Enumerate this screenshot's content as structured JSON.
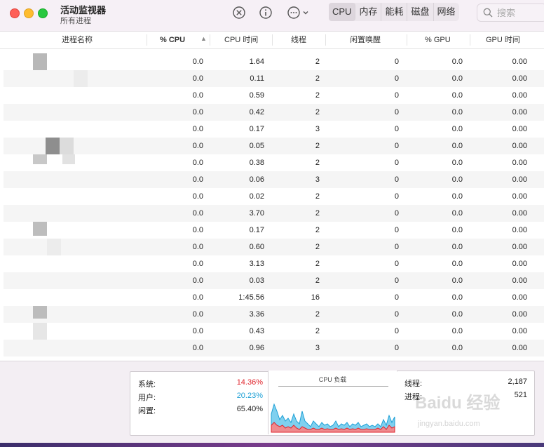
{
  "window": {
    "title": "活动监视器",
    "subtitle": "所有进程"
  },
  "toolbar": {
    "icons": [
      "stop-process-icon",
      "info-icon",
      "more-actions-icon"
    ],
    "tabs": [
      {
        "label": "CPU",
        "active": true
      },
      {
        "label": "内存",
        "active": false
      },
      {
        "label": "能耗",
        "active": false
      },
      {
        "label": "磁盘",
        "active": false
      },
      {
        "label": "网络",
        "active": false
      }
    ],
    "search_placeholder": "搜索"
  },
  "table": {
    "columns": [
      "进程名称",
      "% CPU",
      "CPU 时间",
      "线程",
      "闲置唤醒",
      "% GPU",
      "GPU 时间"
    ],
    "sort_column": "% CPU",
    "rows": [
      {
        "cpu": "0.0",
        "cpu_time": "1.64",
        "threads": "2",
        "idle_wake": "0",
        "gpu": "0.0",
        "gpu_time": "0.00"
      },
      {
        "cpu": "0.0",
        "cpu_time": "0.11",
        "threads": "2",
        "idle_wake": "0",
        "gpu": "0.0",
        "gpu_time": "0.00"
      },
      {
        "cpu": "0.0",
        "cpu_time": "0.59",
        "threads": "2",
        "idle_wake": "0",
        "gpu": "0.0",
        "gpu_time": "0.00"
      },
      {
        "cpu": "0.0",
        "cpu_time": "0.42",
        "threads": "2",
        "idle_wake": "0",
        "gpu": "0.0",
        "gpu_time": "0.00"
      },
      {
        "cpu": "0.0",
        "cpu_time": "0.17",
        "threads": "3",
        "idle_wake": "0",
        "gpu": "0.0",
        "gpu_time": "0.00"
      },
      {
        "cpu": "0.0",
        "cpu_time": "0.05",
        "threads": "2",
        "idle_wake": "0",
        "gpu": "0.0",
        "gpu_time": "0.00"
      },
      {
        "cpu": "0.0",
        "cpu_time": "0.38",
        "threads": "2",
        "idle_wake": "0",
        "gpu": "0.0",
        "gpu_time": "0.00"
      },
      {
        "cpu": "0.0",
        "cpu_time": "0.06",
        "threads": "3",
        "idle_wake": "0",
        "gpu": "0.0",
        "gpu_time": "0.00"
      },
      {
        "cpu": "0.0",
        "cpu_time": "0.02",
        "threads": "2",
        "idle_wake": "0",
        "gpu": "0.0",
        "gpu_time": "0.00"
      },
      {
        "cpu": "0.0",
        "cpu_time": "3.70",
        "threads": "2",
        "idle_wake": "0",
        "gpu": "0.0",
        "gpu_time": "0.00"
      },
      {
        "cpu": "0.0",
        "cpu_time": "0.17",
        "threads": "2",
        "idle_wake": "0",
        "gpu": "0.0",
        "gpu_time": "0.00"
      },
      {
        "cpu": "0.0",
        "cpu_time": "0.60",
        "threads": "2",
        "idle_wake": "0",
        "gpu": "0.0",
        "gpu_time": "0.00"
      },
      {
        "cpu": "0.0",
        "cpu_time": "3.13",
        "threads": "2",
        "idle_wake": "0",
        "gpu": "0.0",
        "gpu_time": "0.00"
      },
      {
        "cpu": "0.0",
        "cpu_time": "0.03",
        "threads": "2",
        "idle_wake": "0",
        "gpu": "0.0",
        "gpu_time": "0.00"
      },
      {
        "cpu": "0.0",
        "cpu_time": "1:45.56",
        "threads": "16",
        "idle_wake": "0",
        "gpu": "0.0",
        "gpu_time": "0.00"
      },
      {
        "cpu": "0.0",
        "cpu_time": "3.36",
        "threads": "2",
        "idle_wake": "0",
        "gpu": "0.0",
        "gpu_time": "0.00"
      },
      {
        "cpu": "0.0",
        "cpu_time": "0.43",
        "threads": "2",
        "idle_wake": "0",
        "gpu": "0.0",
        "gpu_time": "0.00"
      },
      {
        "cpu": "0.0",
        "cpu_time": "0.96",
        "threads": "3",
        "idle_wake": "0",
        "gpu": "0.0",
        "gpu_time": "0.00"
      }
    ]
  },
  "summary": {
    "system_label": "系统:",
    "system_value": "14.36%",
    "user_label": "用户:",
    "user_value": "20.23%",
    "idle_label": "闲置:",
    "idle_value": "65.40%",
    "chart_title": "CPU 负载",
    "threads_label": "线程:",
    "threads_value": "2,187",
    "processes_label": "进程:",
    "processes_value": "521"
  },
  "watermark": {
    "brand": "Baidu 经验",
    "url": "jingyan.baidu.com"
  },
  "colors": {
    "system": "#e0242c",
    "user": "#1ea0d6",
    "accent_bg": "#f6f0f6"
  }
}
